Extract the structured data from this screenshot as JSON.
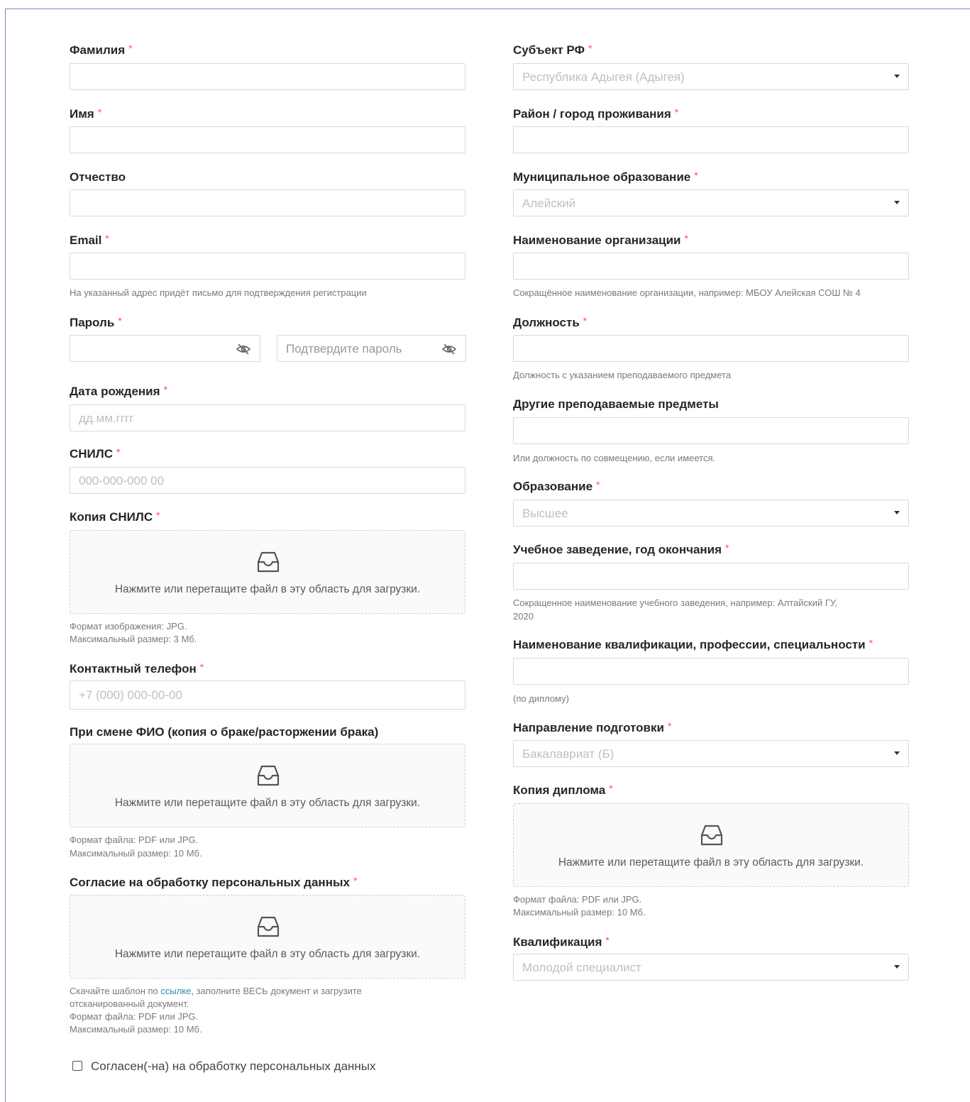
{
  "form": {
    "left": {
      "surname_label": "Фамилия",
      "name_label": "Имя",
      "patronymic_label": "Отчество",
      "email_label": "Email",
      "email_help": "На указанный адрес придёт письмо для подтверждения регистрации",
      "password_label": "Пароль",
      "password_value": "",
      "confirm_password_placeholder": "Подтвердите пароль",
      "birthdate_label": "Дата рождения",
      "birthdate_placeholder": "дд.мм.гггг",
      "snils_label": "СНИЛС",
      "snils_placeholder": "000-000-000 00",
      "snils_copy_label": "Копия СНИЛС",
      "snils_copy_help_1": "Формат изображения: JPG.",
      "snils_copy_help_2": "Максимальный размер: 3 Мб.",
      "phone_label": "Контактный телефон",
      "phone_placeholder": "+7 (000) 000-00-00",
      "name_change_label": "При смене ФИО (копия о браке/расторжении брака)",
      "name_change_help_1": "Формат файла: PDF или JPG.",
      "name_change_help_2": "Максимальный размер: 10 Мб.",
      "consent_label": "Согласие на обработку персональных данных",
      "consent_help_prefix": "Скачайте шаблон по ",
      "consent_help_link": "ссылке",
      "consent_help_suffix": ", заполните ВЕСЬ документ и загрузите",
      "consent_help_2": "отсканированный документ.",
      "consent_help_3": "Формат файла: PDF или JPG.",
      "consent_help_4": "Максимальный размер: 10 Мб.",
      "agree_checkbox_label": "Согласен(-на) на обработку персональных данных"
    },
    "right": {
      "region_label": "Субъект РФ",
      "region_value": "Республика Адыгея (Адыгея)",
      "district_label": "Район / город проживания",
      "municipality_label": "Муниципальное образование",
      "municipality_value": "Алейский",
      "org_label": "Наименование организации",
      "org_help": "Сокращённое наименование организации, например: МБОУ Алейская СОШ № 4",
      "position_label": "Должность",
      "position_help": "Должность с указанием преподаваемого предмета",
      "other_subjects_label": "Другие преподаваемые предметы",
      "other_subjects_help": "Или должность по совмещению, если имеется.",
      "education_label": "Образование",
      "education_value": "Высшее",
      "institution_label": "Учебное заведение, год окончания",
      "institution_help_1": "Сокращенное наименование учебного заведения, например: Алтайский ГУ,",
      "institution_help_2": "2020",
      "qualification_name_label": "Наименование квалификации, профессии, специальности",
      "qualification_name_help": "(по диплому)",
      "direction_label": "Направление подготовки",
      "direction_value": "Бакалавриат (Б)",
      "diploma_label": "Копия диплома",
      "diploma_help_1": "Формат файла: PDF или JPG.",
      "diploma_help_2": "Максимальный размер: 10 Мб.",
      "qualification_label": "Квалификация",
      "qualification_value": "Молодой специалист"
    },
    "required_mark": "*",
    "upload_text": "Нажмите или перетащите файл в эту область для загрузки."
  },
  "icons": {
    "upload": "inbox-icon",
    "password_toggle": "eye-invisible-icon",
    "select_caret": "caret-down-icon"
  },
  "colors": {
    "required": "#ff4d4f",
    "link": "#2a8ca0",
    "border": "#d9d9d9",
    "placeholder": "#bfbfbf"
  }
}
